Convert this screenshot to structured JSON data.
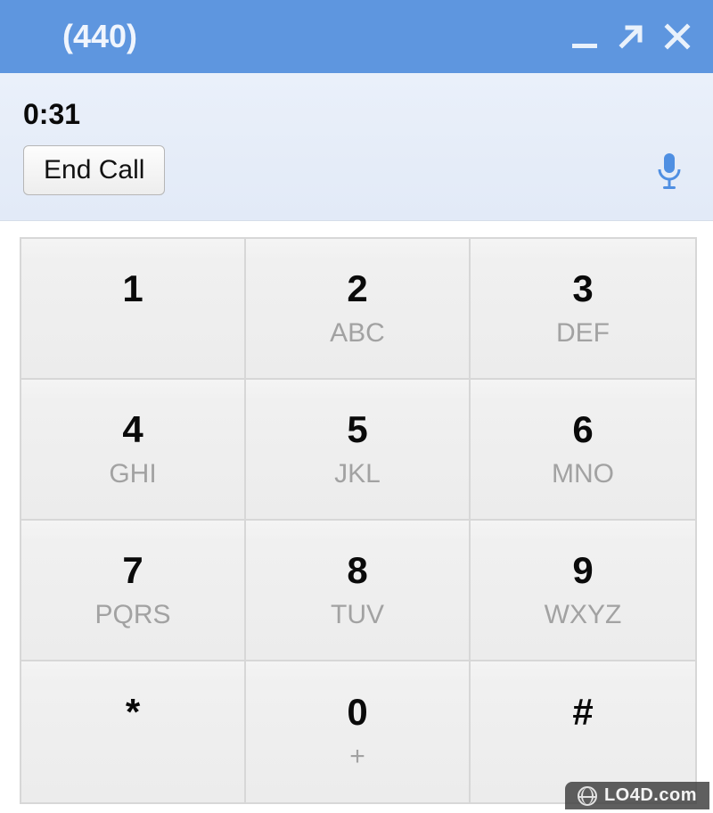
{
  "titlebar": {
    "title": "(440)"
  },
  "call": {
    "duration": "0:31",
    "end_call_label": "End Call"
  },
  "dialpad": {
    "keys": [
      {
        "num": "1",
        "letters": ""
      },
      {
        "num": "2",
        "letters": "ABC"
      },
      {
        "num": "3",
        "letters": "DEF"
      },
      {
        "num": "4",
        "letters": "GHI"
      },
      {
        "num": "5",
        "letters": "JKL"
      },
      {
        "num": "6",
        "letters": "MNO"
      },
      {
        "num": "7",
        "letters": "PQRS"
      },
      {
        "num": "8",
        "letters": "TUV"
      },
      {
        "num": "9",
        "letters": "WXYZ"
      },
      {
        "num": "*",
        "letters": ""
      },
      {
        "num": "0",
        "letters": "+"
      },
      {
        "num": "#",
        "letters": ""
      }
    ]
  },
  "watermark": {
    "text": "LO4D.com"
  },
  "colors": {
    "titlebar_bg": "#5e96df",
    "accent_blue": "#4f8fe2",
    "key_border": "#d7d7d7",
    "key_letters": "#a2a2a2"
  },
  "icons": {
    "minimize": "minimize-icon",
    "popout": "popout-icon",
    "close": "close-icon",
    "microphone": "microphone-icon"
  }
}
